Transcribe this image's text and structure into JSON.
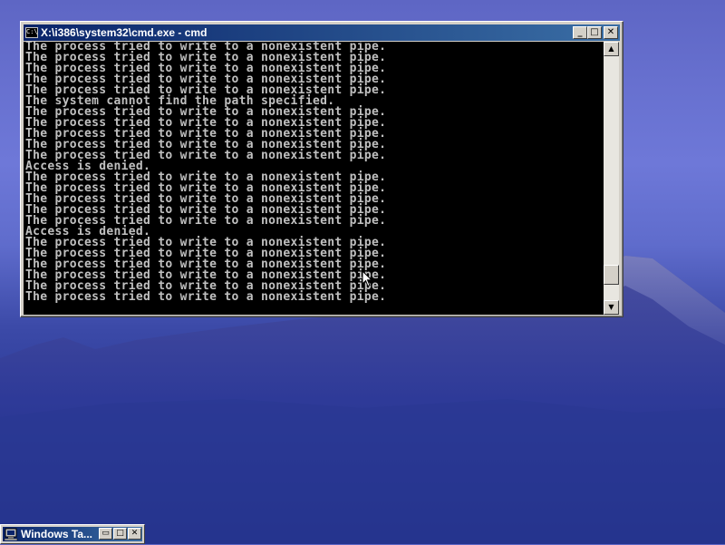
{
  "window": {
    "title": "X:\\i386\\system32\\cmd.exe - cmd",
    "icon": "cmd-icon",
    "icon_text": "C:\\",
    "buttons": {
      "minimize": "_",
      "maximize": "□",
      "close": "✕"
    }
  },
  "console": {
    "lines": [
      "The process tried to write to a nonexistent pipe.",
      "The process tried to write to a nonexistent pipe.",
      "The process tried to write to a nonexistent pipe.",
      "The process tried to write to a nonexistent pipe.",
      "The process tried to write to a nonexistent pipe.",
      "The system cannot find the path specified.",
      "The process tried to write to a nonexistent pipe.",
      "The process tried to write to a nonexistent pipe.",
      "The process tried to write to a nonexistent pipe.",
      "The process tried to write to a nonexistent pipe.",
      "The process tried to write to a nonexistent pipe.",
      "Access is denied.",
      "The process tried to write to a nonexistent pipe.",
      "The process tried to write to a nonexistent pipe.",
      "The process tried to write to a nonexistent pipe.",
      "The process tried to write to a nonexistent pipe.",
      "The process tried to write to a nonexistent pipe.",
      "Access is denied.",
      "The process tried to write to a nonexistent pipe.",
      "The process tried to write to a nonexistent pipe.",
      "The process tried to write to a nonexistent pipe.",
      "The process tried to write to a nonexistent pipe.",
      "The process tried to write to a nonexistent pipe.",
      "The process tried to write to a nonexistent pipe."
    ],
    "text_color": "#c0c0c0",
    "background": "#000000"
  },
  "scrollbar": {
    "up_arrow": "▲",
    "down_arrow": "▼",
    "position": 0.93
  },
  "taskbar_window": {
    "title": "Windows Ta...",
    "icon": "computer-icon",
    "buttons": {
      "restore": "▭",
      "maximize": "□",
      "close": "✕"
    }
  },
  "colors": {
    "titlebar_start": "#0a246a",
    "titlebar_end": "#3a6ea5",
    "window_face": "#d4d0c8"
  }
}
